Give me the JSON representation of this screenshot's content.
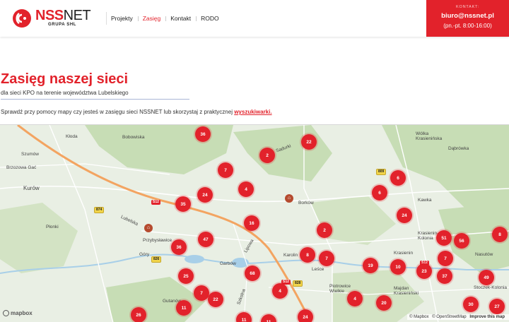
{
  "header": {
    "logo": {
      "brand_a": "NSS",
      "brand_b": "NET",
      "sub": "GRUPA SHL"
    },
    "nav": [
      "Projekty",
      "Zasięg",
      "Kontakt",
      "RODO"
    ],
    "nav_active": "Zasięg",
    "contact": {
      "label": "KONTAKT:",
      "email": "biuro@nssnet.pl",
      "hours": "(pn.-pt. 8:00-16:00)"
    }
  },
  "page": {
    "title": "Zasięg naszej sieci",
    "subtitle": "dla sieci KPO na terenie województwa Lubelskiego",
    "intro": "Sprawdź przy pomocy mapy czy jesteś w zasięgu sieci NSSNET lub skorzystaj z praktycznej",
    "intro_link": "wyszukiwarki."
  },
  "map": {
    "places": [
      "Kłoda",
      "Bobowiska",
      "Szumów",
      "Brzozowa Gać",
      "Kurów",
      "Płonki",
      "Góry",
      "Przybysławice",
      "Gutanów",
      "Garbów",
      "Lipowa",
      "Borków",
      "Karolin",
      "Leśce",
      "Piotrowice Wielkie",
      "Majdan Krasieniński",
      "Krasienin",
      "Krasienin-Kolonia",
      "Nasutów",
      "Stoczek-Kolonia",
      "Wólka Krasienińska",
      "Dąbrówka",
      "Kawka",
      "Lubelska",
      "Sadurki",
      "Szkolna"
    ],
    "road_labels": [
      "S12",
      "874",
      "826",
      "809",
      "S12",
      "828",
      "S12"
    ],
    "clusters": [
      {
        "count": "36"
      },
      {
        "count": "22"
      },
      {
        "count": "2"
      },
      {
        "count": "7"
      },
      {
        "count": "4"
      },
      {
        "count": "24"
      },
      {
        "count": "35"
      },
      {
        "count": "16"
      },
      {
        "count": "47"
      },
      {
        "count": "36"
      },
      {
        "count": "2"
      },
      {
        "count": "6"
      },
      {
        "count": "6"
      },
      {
        "count": "24"
      },
      {
        "count": "8"
      },
      {
        "count": "7"
      },
      {
        "count": "19"
      },
      {
        "count": "10"
      },
      {
        "count": "7"
      },
      {
        "count": "23"
      },
      {
        "count": "37"
      },
      {
        "count": "51"
      },
      {
        "count": "56"
      },
      {
        "count": "8"
      },
      {
        "count": "25"
      },
      {
        "count": "68"
      },
      {
        "count": "7"
      },
      {
        "count": "22"
      },
      {
        "count": "4"
      },
      {
        "count": "4"
      },
      {
        "count": "11"
      },
      {
        "count": "20"
      },
      {
        "count": "49"
      },
      {
        "count": "30"
      },
      {
        "count": "27"
      },
      {
        "count": "26"
      },
      {
        "count": "11"
      },
      {
        "count": "24"
      },
      {
        "count": "11"
      }
    ],
    "branding": "mapbox",
    "attribution": [
      "© Mapbox",
      "© OpenStreetMap",
      "Improve this map"
    ]
  },
  "colors": {
    "brand_red": "#e2222b",
    "map_bg": "#e9efe4",
    "forest": "#c7ddb5",
    "water": "#a8cfe8"
  }
}
